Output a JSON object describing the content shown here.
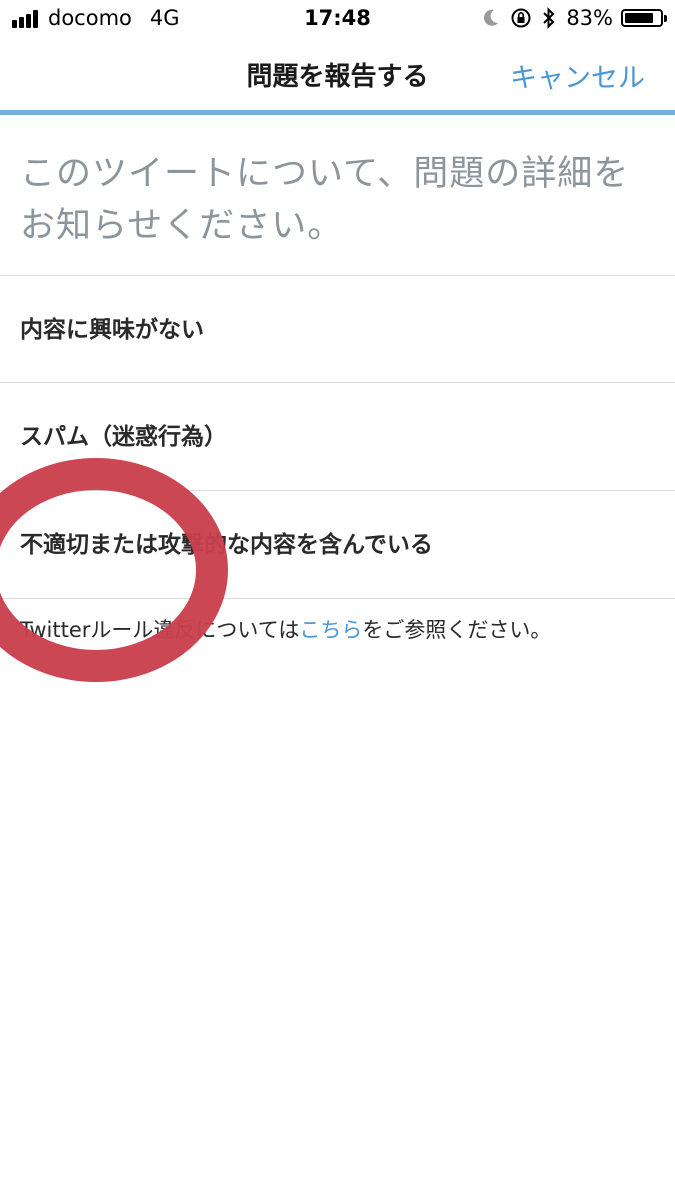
{
  "status_bar": {
    "carrier": "docomo",
    "network": "4G",
    "time": "17:48",
    "battery_percent_text": "83%",
    "battery_level": 0.83,
    "icons": [
      "signal-bars-icon",
      "moon-icon",
      "rotation-lock-icon",
      "bluetooth-icon",
      "battery-icon"
    ]
  },
  "nav": {
    "title": "問題を報告する",
    "cancel_label": "キャンセル"
  },
  "prompt": {
    "text": "このツイートについて、問題の詳細をお知らせください。"
  },
  "options": [
    {
      "label": "内容に興味がない"
    },
    {
      "label": "スパム（迷惑行為）"
    },
    {
      "label": "不適切または攻撃的な内容を含んでいる"
    }
  ],
  "footer": {
    "prefix": "Twitterルール違反については",
    "link": "こちら",
    "suffix": "をご参照ください。"
  },
  "colors": {
    "accent_blue": "#4a97d4",
    "nav_underline": "#76aedc",
    "annotation_red": "#c9404c",
    "prompt_gray": "#8d959c",
    "divider": "#d9dde2"
  }
}
